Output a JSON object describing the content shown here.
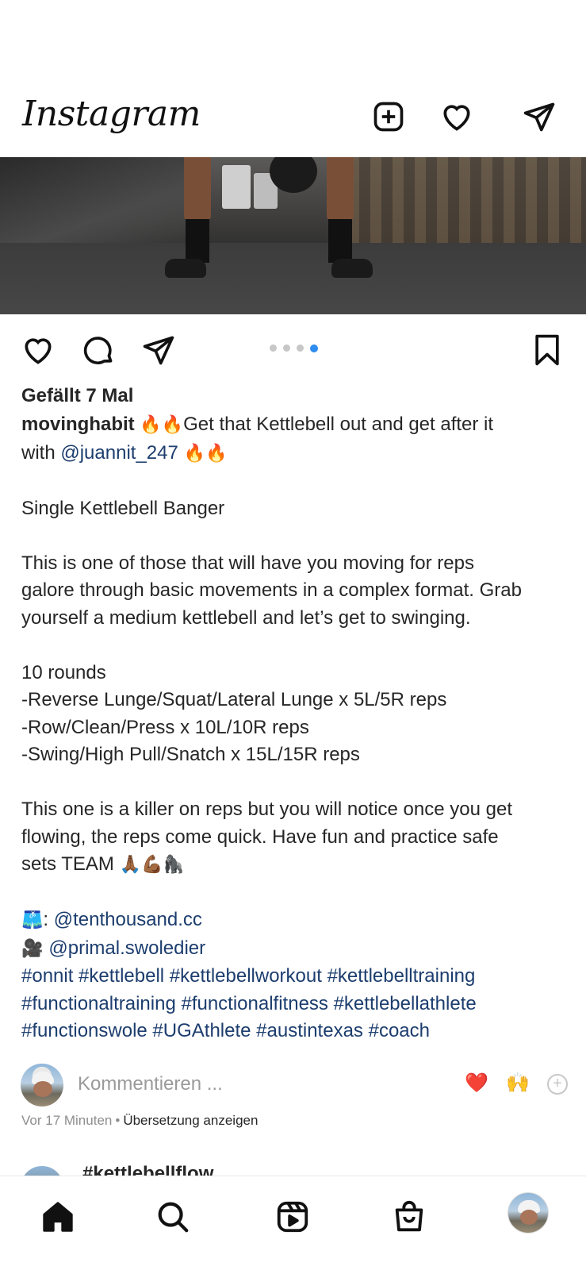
{
  "app": {
    "name": "Instagram"
  },
  "post": {
    "likes_text": "Gefällt 7 Mal",
    "carousel": {
      "count": 4,
      "active_index": 3
    },
    "caption": {
      "username": "movinghabit",
      "line1_emoji": "🔥🔥",
      "line1_text": "Get that Kettlebell out and get after it",
      "line2_prefix": "with ",
      "line2_mention": "@juannit_247",
      "line2_emoji": " 🔥🔥",
      "title": "Single Kettlebell Banger",
      "para1": [
        "This is one of those that will have you moving for reps",
        "galore through basic movements in a complex format. Grab",
        "yourself a medium kettlebell and let’s get to swinging."
      ],
      "rounds": "10 rounds",
      "exercises": [
        "-Reverse Lunge/Squat/Lateral Lunge x 5L/5R reps",
        "-Row/Clean/Press x 10L/10R reps",
        "-Swing/High Pull/Snatch x 15L/15R reps"
      ],
      "para2": [
        "This one is a killer on reps but you will notice once you get",
        "flowing, the reps come quick. Have fun and practice safe"
      ],
      "para2_last_text": "sets TEAM ",
      "para2_last_emoji": "🙏🏾💪🏾🦍",
      "credit1_emoji": "🩳",
      "credit1_sep": ": ",
      "credit1_mention": "@tenthousand.cc",
      "credit2_emoji": "🎥 ",
      "credit2_mention": "@primal.swoledier",
      "hashtag_lines": [
        "#onnit #kettlebell #kettlebellworkout #kettlebelltraining",
        "#functionaltraining #functionalfitness #kettlebellathlete",
        "#functionswole #UGAthlete #austintexas #coach"
      ]
    },
    "comment": {
      "placeholder": "Kommentieren ...",
      "reaction1": "❤️",
      "reaction2": "🙌",
      "add_reaction": "+"
    },
    "meta": {
      "time": "Vor 17 Minuten",
      "separator": "•",
      "translate": "Übersetzung anzeigen"
    }
  },
  "next_post": {
    "title": "#kettlebellflow"
  },
  "icons": {
    "header": [
      "new-post-icon",
      "heart-icon",
      "direct-message-icon"
    ],
    "actions": [
      "like-icon",
      "comment-icon",
      "share-icon",
      "save-icon"
    ],
    "nav": [
      "home-icon",
      "search-icon",
      "reels-icon",
      "shop-icon",
      "profile-avatar"
    ]
  },
  "colors": {
    "link": "#1c3d6e",
    "accent_dot": "#2f8cf0",
    "muted": "#8e8e8e"
  }
}
